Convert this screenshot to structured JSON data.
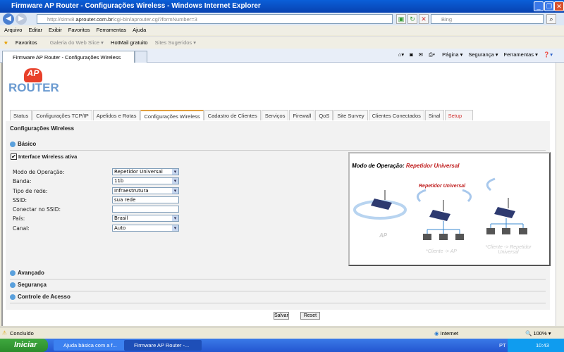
{
  "window": {
    "title": "Firmware AP Router - Configurações Wireless - Windows Internet Explorer"
  },
  "browser": {
    "url_prefix": "http://simv8.",
    "url_domain": "aprouter.com.br",
    "url_path": "/cgi-bin/aprouter.cgi?formNumber=3",
    "search_placeholder": "Bing",
    "menu": [
      "Arquivo",
      "Editar",
      "Exibir",
      "Favoritos",
      "Ferramentas",
      "Ajuda"
    ],
    "favorites_label": "Favoritos",
    "fav_items": [
      "Galeria do Web Slice ▾",
      "HotMail gratuito",
      "Sites Sugeridos ▾"
    ],
    "tab_title": "Firmware AP Router - Configurações Wireless",
    "command_bar": [
      "Página ▾",
      "Segurança ▾",
      "Ferramentas ▾"
    ]
  },
  "page": {
    "logo_text": "ROUTER",
    "logo_mark": "AP",
    "tabs": [
      "Status",
      "Configurações TCP/IP",
      "Apelidos e Rotas",
      "Configurações Wireless",
      "Cadastro de Clientes",
      "Serviços",
      "Firewall",
      "QoS",
      "Site Survey",
      "Clientes Conectados",
      "Sinal",
      "Setup"
    ],
    "heading": "Configurações Wireless",
    "basic_section": "Básico",
    "wireless_active_label": "Interface Wireless ativa",
    "fields": [
      {
        "label": "Modo de Operação:",
        "value": "Repetidor Universal",
        "type": "select"
      },
      {
        "label": "Banda:",
        "value": "11b",
        "type": "select"
      },
      {
        "label": "Tipo de rede:",
        "value": "Infraestrutura",
        "type": "select"
      },
      {
        "label": "SSID:",
        "value": "sua rede",
        "type": "input"
      },
      {
        "label": "Conectar no SSID:",
        "value": "",
        "type": "input"
      },
      {
        "label": "País:",
        "value": "Brasil",
        "type": "select"
      },
      {
        "label": "Canal:",
        "value": "Auto",
        "type": "select"
      }
    ],
    "diagram": {
      "title": "Modo de Operação:",
      "mode": "Repetidor Universal",
      "center_label": "Repetidor Universal",
      "ap_label": "AP",
      "client_ap": "*Cliente -> AP",
      "client_rep": "*Cliente -> Repetidor Universal"
    },
    "sections": [
      "Avançado",
      "Segurança",
      "Controle de Acesso"
    ],
    "save": "Salvar",
    "reset": "Reset"
  },
  "status": {
    "text": "Concluído",
    "zone": "Internet",
    "zoom": "100%"
  },
  "taskbar": {
    "start": "Iniciar",
    "tasks": [
      "Ajuda básica com a f...",
      "Firmware AP Router -..."
    ],
    "lang": "PT",
    "clock": "10:43"
  }
}
